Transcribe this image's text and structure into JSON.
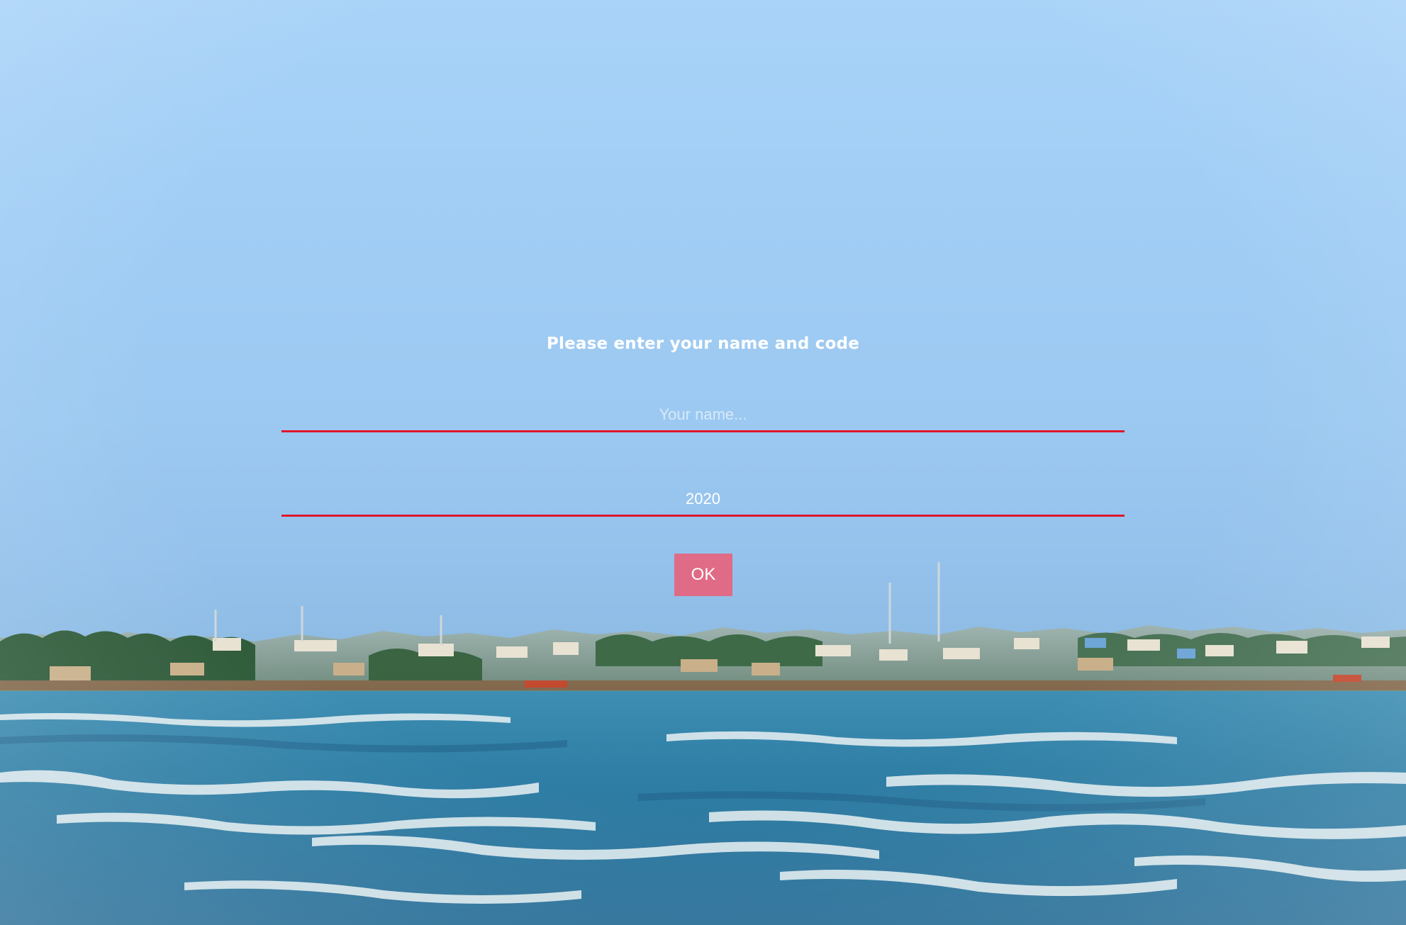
{
  "background": {
    "description_icon": "beach-photo-icon",
    "sky_color": "#a2cef6",
    "sea_color": "#2f7fa6",
    "accent_red": "#e0162b",
    "button_color": "#e06b86"
  },
  "form": {
    "title": "Please enter your name and code",
    "name_field": {
      "value": "",
      "placeholder": "Your name..."
    },
    "code_field": {
      "value": "2020",
      "placeholder": ""
    },
    "ok_label": "OK"
  }
}
